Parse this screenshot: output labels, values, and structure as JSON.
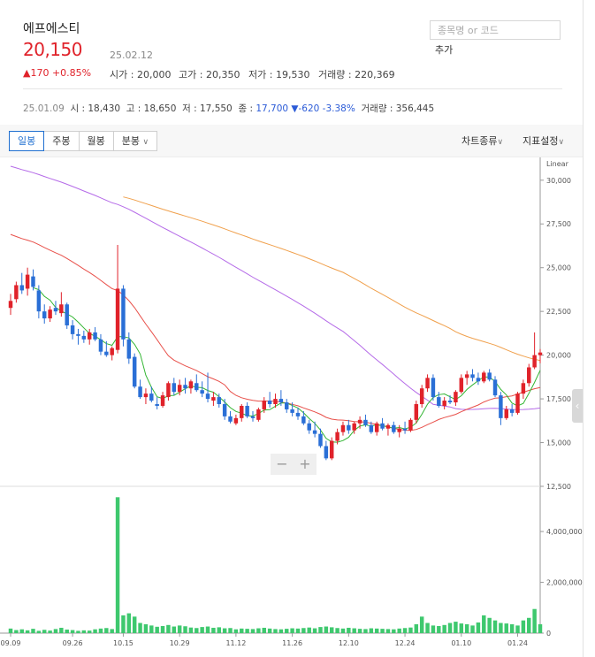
{
  "stock": {
    "name": "에프에스티",
    "price": "20,150",
    "date": "25.02.12",
    "change": "▲170 +0.85%",
    "open_label": "시가",
    "open": "20,000",
    "high_label": "고가",
    "high": "20,350",
    "low_label": "저가",
    "low": "19,530",
    "volume_label": "거래량",
    "volume": "220,369"
  },
  "search": {
    "placeholder": "종목명 or 코드",
    "add_label": "추가"
  },
  "previous": {
    "date": "25.01.09",
    "open_label": "시",
    "open": "18,430",
    "high_label": "고",
    "high": "18,650",
    "low_label": "저",
    "low": "17,550",
    "close_label": "종",
    "close": "17,700",
    "change": "▼-620 -3.38%",
    "volume_label": "거래량",
    "volume": "356,445"
  },
  "toolbar": {
    "tabs": [
      "일봉",
      "주봉",
      "월봉",
      "분봉"
    ],
    "active_tab": 0,
    "chart_type_label": "차트종류",
    "indicator_label": "지표설정"
  },
  "colors": {
    "up": "#e0222a",
    "down": "#2a6fd6",
    "ma5": "#32b532",
    "ma20": "#e8504a",
    "ma60": "#b56be8",
    "ma120": "#f0a04c",
    "volume": "#3ec86e"
  },
  "chart_data": {
    "type": "candlestick",
    "scale_label": "Linear",
    "price_ticks": [
      "30,000",
      "27,500",
      "25,000",
      "22,500",
      "20,000",
      "17,500",
      "15,000",
      "12,500"
    ],
    "volume_ticks": [
      "4,000,000",
      "2,000,000",
      "0"
    ],
    "x_labels": [
      "09.09",
      "09.26",
      "10.15",
      "10.29",
      "11.12",
      "11.26",
      "12.10",
      "12.24",
      "01.10",
      "01.24"
    ],
    "x_label_index": [
      0,
      11,
      20,
      30,
      40,
      50,
      60,
      70,
      80,
      90
    ],
    "candles": [
      {
        "o": 22700,
        "h": 23500,
        "l": 22300,
        "c": 23100
      },
      {
        "o": 23200,
        "h": 24200,
        "l": 23000,
        "c": 24000
      },
      {
        "o": 24000,
        "h": 24700,
        "l": 23500,
        "c": 23700
      },
      {
        "o": 23800,
        "h": 25000,
        "l": 23400,
        "c": 24600
      },
      {
        "o": 24500,
        "h": 24900,
        "l": 23700,
        "c": 23900
      },
      {
        "o": 23700,
        "h": 24000,
        "l": 22100,
        "c": 22500
      },
      {
        "o": 22500,
        "h": 22900,
        "l": 21800,
        "c": 22100
      },
      {
        "o": 22100,
        "h": 22800,
        "l": 21900,
        "c": 22600
      },
      {
        "o": 22700,
        "h": 23100,
        "l": 22300,
        "c": 22500
      },
      {
        "o": 22400,
        "h": 23600,
        "l": 22200,
        "c": 22900
      },
      {
        "o": 22900,
        "h": 23000,
        "l": 21500,
        "c": 21700
      },
      {
        "o": 21700,
        "h": 22000,
        "l": 20900,
        "c": 21200
      },
      {
        "o": 21200,
        "h": 21500,
        "l": 20600,
        "c": 21100
      },
      {
        "o": 21100,
        "h": 21400,
        "l": 20700,
        "c": 20900
      },
      {
        "o": 20900,
        "h": 21500,
        "l": 20600,
        "c": 21300
      },
      {
        "o": 21300,
        "h": 21600,
        "l": 20800,
        "c": 20900
      },
      {
        "o": 20900,
        "h": 21200,
        "l": 20000,
        "c": 20200
      },
      {
        "o": 20200,
        "h": 20800,
        "l": 19900,
        "c": 20000
      },
      {
        "o": 20000,
        "h": 20500,
        "l": 19700,
        "c": 20400
      },
      {
        "o": 20300,
        "h": 26300,
        "l": 20100,
        "c": 23800
      },
      {
        "o": 23800,
        "h": 24000,
        "l": 20500,
        "c": 20900
      },
      {
        "o": 20900,
        "h": 21300,
        "l": 19500,
        "c": 19800
      },
      {
        "o": 19900,
        "h": 20100,
        "l": 18100,
        "c": 18200
      },
      {
        "o": 18200,
        "h": 18600,
        "l": 17500,
        "c": 17600
      },
      {
        "o": 17600,
        "h": 18100,
        "l": 17200,
        "c": 17800
      },
      {
        "o": 17800,
        "h": 18200,
        "l": 17300,
        "c": 17400
      },
      {
        "o": 17200,
        "h": 17600,
        "l": 16900,
        "c": 17100
      },
      {
        "o": 17100,
        "h": 17900,
        "l": 17000,
        "c": 17700
      },
      {
        "o": 17600,
        "h": 18500,
        "l": 17400,
        "c": 18400
      },
      {
        "o": 18400,
        "h": 18700,
        "l": 17700,
        "c": 17900
      },
      {
        "o": 17900,
        "h": 18600,
        "l": 17700,
        "c": 18300
      },
      {
        "o": 18300,
        "h": 18700,
        "l": 17800,
        "c": 18100
      },
      {
        "o": 18100,
        "h": 18600,
        "l": 17800,
        "c": 18500
      },
      {
        "o": 18400,
        "h": 18900,
        "l": 17900,
        "c": 18000
      },
      {
        "o": 18000,
        "h": 18500,
        "l": 17600,
        "c": 17800
      },
      {
        "o": 17800,
        "h": 19000,
        "l": 17300,
        "c": 17500
      },
      {
        "o": 17400,
        "h": 17900,
        "l": 17100,
        "c": 17600
      },
      {
        "o": 17600,
        "h": 17800,
        "l": 17000,
        "c": 17200
      },
      {
        "o": 17200,
        "h": 17500,
        "l": 16300,
        "c": 16500
      },
      {
        "o": 16500,
        "h": 16800,
        "l": 16100,
        "c": 16200
      },
      {
        "o": 16100,
        "h": 16600,
        "l": 16000,
        "c": 16400
      },
      {
        "o": 16400,
        "h": 17200,
        "l": 16200,
        "c": 17100
      },
      {
        "o": 17100,
        "h": 17300,
        "l": 16400,
        "c": 16500
      },
      {
        "o": 16500,
        "h": 16800,
        "l": 16200,
        "c": 16400
      },
      {
        "o": 16300,
        "h": 17000,
        "l": 16200,
        "c": 16900
      },
      {
        "o": 16900,
        "h": 17600,
        "l": 16700,
        "c": 17400
      },
      {
        "o": 17400,
        "h": 17900,
        "l": 17000,
        "c": 17200
      },
      {
        "o": 17200,
        "h": 17800,
        "l": 17000,
        "c": 17500
      },
      {
        "o": 17500,
        "h": 18000,
        "l": 17100,
        "c": 17300
      },
      {
        "o": 17300,
        "h": 17500,
        "l": 16700,
        "c": 16900
      },
      {
        "o": 16900,
        "h": 17300,
        "l": 16500,
        "c": 16700
      },
      {
        "o": 16700,
        "h": 17000,
        "l": 16300,
        "c": 16500
      },
      {
        "o": 16500,
        "h": 16800,
        "l": 16000,
        "c": 16100
      },
      {
        "o": 16100,
        "h": 16300,
        "l": 15500,
        "c": 15700
      },
      {
        "o": 15700,
        "h": 16200,
        "l": 15300,
        "c": 15500
      },
      {
        "o": 15500,
        "h": 15800,
        "l": 14700,
        "c": 14800
      },
      {
        "o": 14800,
        "h": 15100,
        "l": 14000,
        "c": 14100
      },
      {
        "o": 14100,
        "h": 15300,
        "l": 14000,
        "c": 15100
      },
      {
        "o": 15100,
        "h": 15800,
        "l": 14900,
        "c": 15600
      },
      {
        "o": 15600,
        "h": 16200,
        "l": 15400,
        "c": 16000
      },
      {
        "o": 16000,
        "h": 16300,
        "l": 15500,
        "c": 15700
      },
      {
        "o": 15700,
        "h": 16200,
        "l": 15500,
        "c": 16100
      },
      {
        "o": 16100,
        "h": 16500,
        "l": 15800,
        "c": 16300
      },
      {
        "o": 16300,
        "h": 16600,
        "l": 15900,
        "c": 16000
      },
      {
        "o": 16000,
        "h": 16200,
        "l": 15500,
        "c": 15600
      },
      {
        "o": 15600,
        "h": 16200,
        "l": 15400,
        "c": 16100
      },
      {
        "o": 16100,
        "h": 16400,
        "l": 15700,
        "c": 15800
      },
      {
        "o": 15800,
        "h": 16100,
        "l": 15400,
        "c": 16000
      },
      {
        "o": 16000,
        "h": 16200,
        "l": 15500,
        "c": 15600
      },
      {
        "o": 15600,
        "h": 16000,
        "l": 15300,
        "c": 15800
      },
      {
        "o": 15800,
        "h": 16200,
        "l": 15500,
        "c": 15700
      },
      {
        "o": 15700,
        "h": 16400,
        "l": 15600,
        "c": 16300
      },
      {
        "o": 16300,
        "h": 17400,
        "l": 16100,
        "c": 17200
      },
      {
        "o": 17200,
        "h": 18300,
        "l": 17000,
        "c": 18100
      },
      {
        "o": 18100,
        "h": 18900,
        "l": 17900,
        "c": 18700
      },
      {
        "o": 18700,
        "h": 18900,
        "l": 17400,
        "c": 17600
      },
      {
        "o": 17600,
        "h": 17900,
        "l": 17000,
        "c": 17100
      },
      {
        "o": 17100,
        "h": 17600,
        "l": 16900,
        "c": 17400
      },
      {
        "o": 17400,
        "h": 17700,
        "l": 17200,
        "c": 17300
      },
      {
        "o": 17300,
        "h": 18000,
        "l": 17100,
        "c": 17900
      },
      {
        "o": 17900,
        "h": 18900,
        "l": 17800,
        "c": 18700
      },
      {
        "o": 18700,
        "h": 19100,
        "l": 18300,
        "c": 18900
      },
      {
        "o": 18900,
        "h": 19200,
        "l": 18500,
        "c": 18700
      },
      {
        "o": 18700,
        "h": 19000,
        "l": 18300,
        "c": 18500
      },
      {
        "o": 18500,
        "h": 19100,
        "l": 18400,
        "c": 19000
      },
      {
        "o": 19000,
        "h": 19200,
        "l": 18500,
        "c": 18600
      },
      {
        "o": 18600,
        "h": 18800,
        "l": 17600,
        "c": 17700
      },
      {
        "o": 17700,
        "h": 17900,
        "l": 16000,
        "c": 16400
      },
      {
        "o": 16400,
        "h": 17100,
        "l": 16300,
        "c": 16900
      },
      {
        "o": 16900,
        "h": 17200,
        "l": 16500,
        "c": 16700
      },
      {
        "o": 16700,
        "h": 17900,
        "l": 16600,
        "c": 17800
      },
      {
        "o": 17800,
        "h": 18600,
        "l": 17500,
        "c": 18400
      },
      {
        "o": 18400,
        "h": 19500,
        "l": 18200,
        "c": 19300
      },
      {
        "o": 19300,
        "h": 21300,
        "l": 19200,
        "c": 20000
      },
      {
        "o": 20000,
        "h": 20350,
        "l": 19530,
        "c": 20150
      }
    ],
    "volumes": [
      180000,
      120000,
      150000,
      110000,
      170000,
      90000,
      130000,
      100000,
      160000,
      210000,
      140000,
      120000,
      90000,
      110000,
      100000,
      150000,
      180000,
      200000,
      160000,
      5350000,
      700000,
      780000,
      650000,
      400000,
      350000,
      300000,
      250000,
      280000,
      320000,
      260000,
      300000,
      270000,
      220000,
      200000,
      240000,
      260000,
      210000,
      230000,
      190000,
      200000,
      150000,
      180000,
      170000,
      160000,
      190000,
      210000,
      180000,
      160000,
      150000,
      170000,
      190000,
      180000,
      200000,
      220000,
      190000,
      240000,
      260000,
      230000,
      200000,
      180000,
      210000,
      190000,
      170000,
      160000,
      190000,
      180000,
      170000,
      160000,
      150000,
      180000,
      200000,
      220000,
      350000,
      650000,
      400000,
      300000,
      280000,
      320000,
      400000,
      450000,
      380000,
      350000,
      300000,
      420000,
      700000,
      600000,
      500000,
      400000,
      380000,
      350000,
      300000,
      500000,
      600000,
      950000,
      350000
    ],
    "ylim": [
      12500,
      31000
    ],
    "vol_max": 5500000
  }
}
